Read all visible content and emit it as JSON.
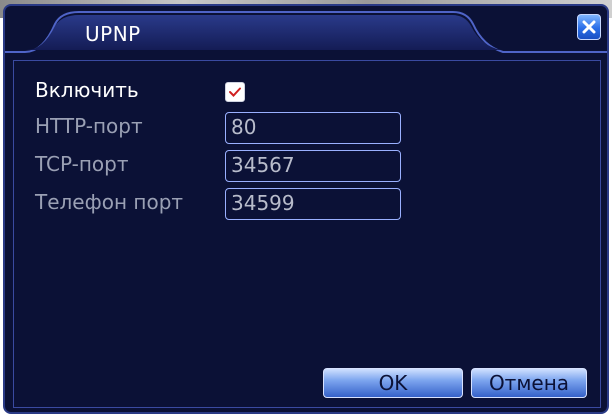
{
  "dialog": {
    "title": "UPNP",
    "close_icon": "close-icon"
  },
  "fields": {
    "enable_label": "Включить",
    "enable_checked": true,
    "http_label": "HTTP-порт",
    "http_value": "80",
    "tcp_label": "TCP-порт",
    "tcp_value": "34567",
    "phone_label": "Телефон порт",
    "phone_value": "34599"
  },
  "buttons": {
    "ok_label": "OK",
    "cancel_label": "Отмена"
  },
  "colors": {
    "background": "#0b1136",
    "accent": "#2a6ee8",
    "check_mark": "#d02020"
  }
}
